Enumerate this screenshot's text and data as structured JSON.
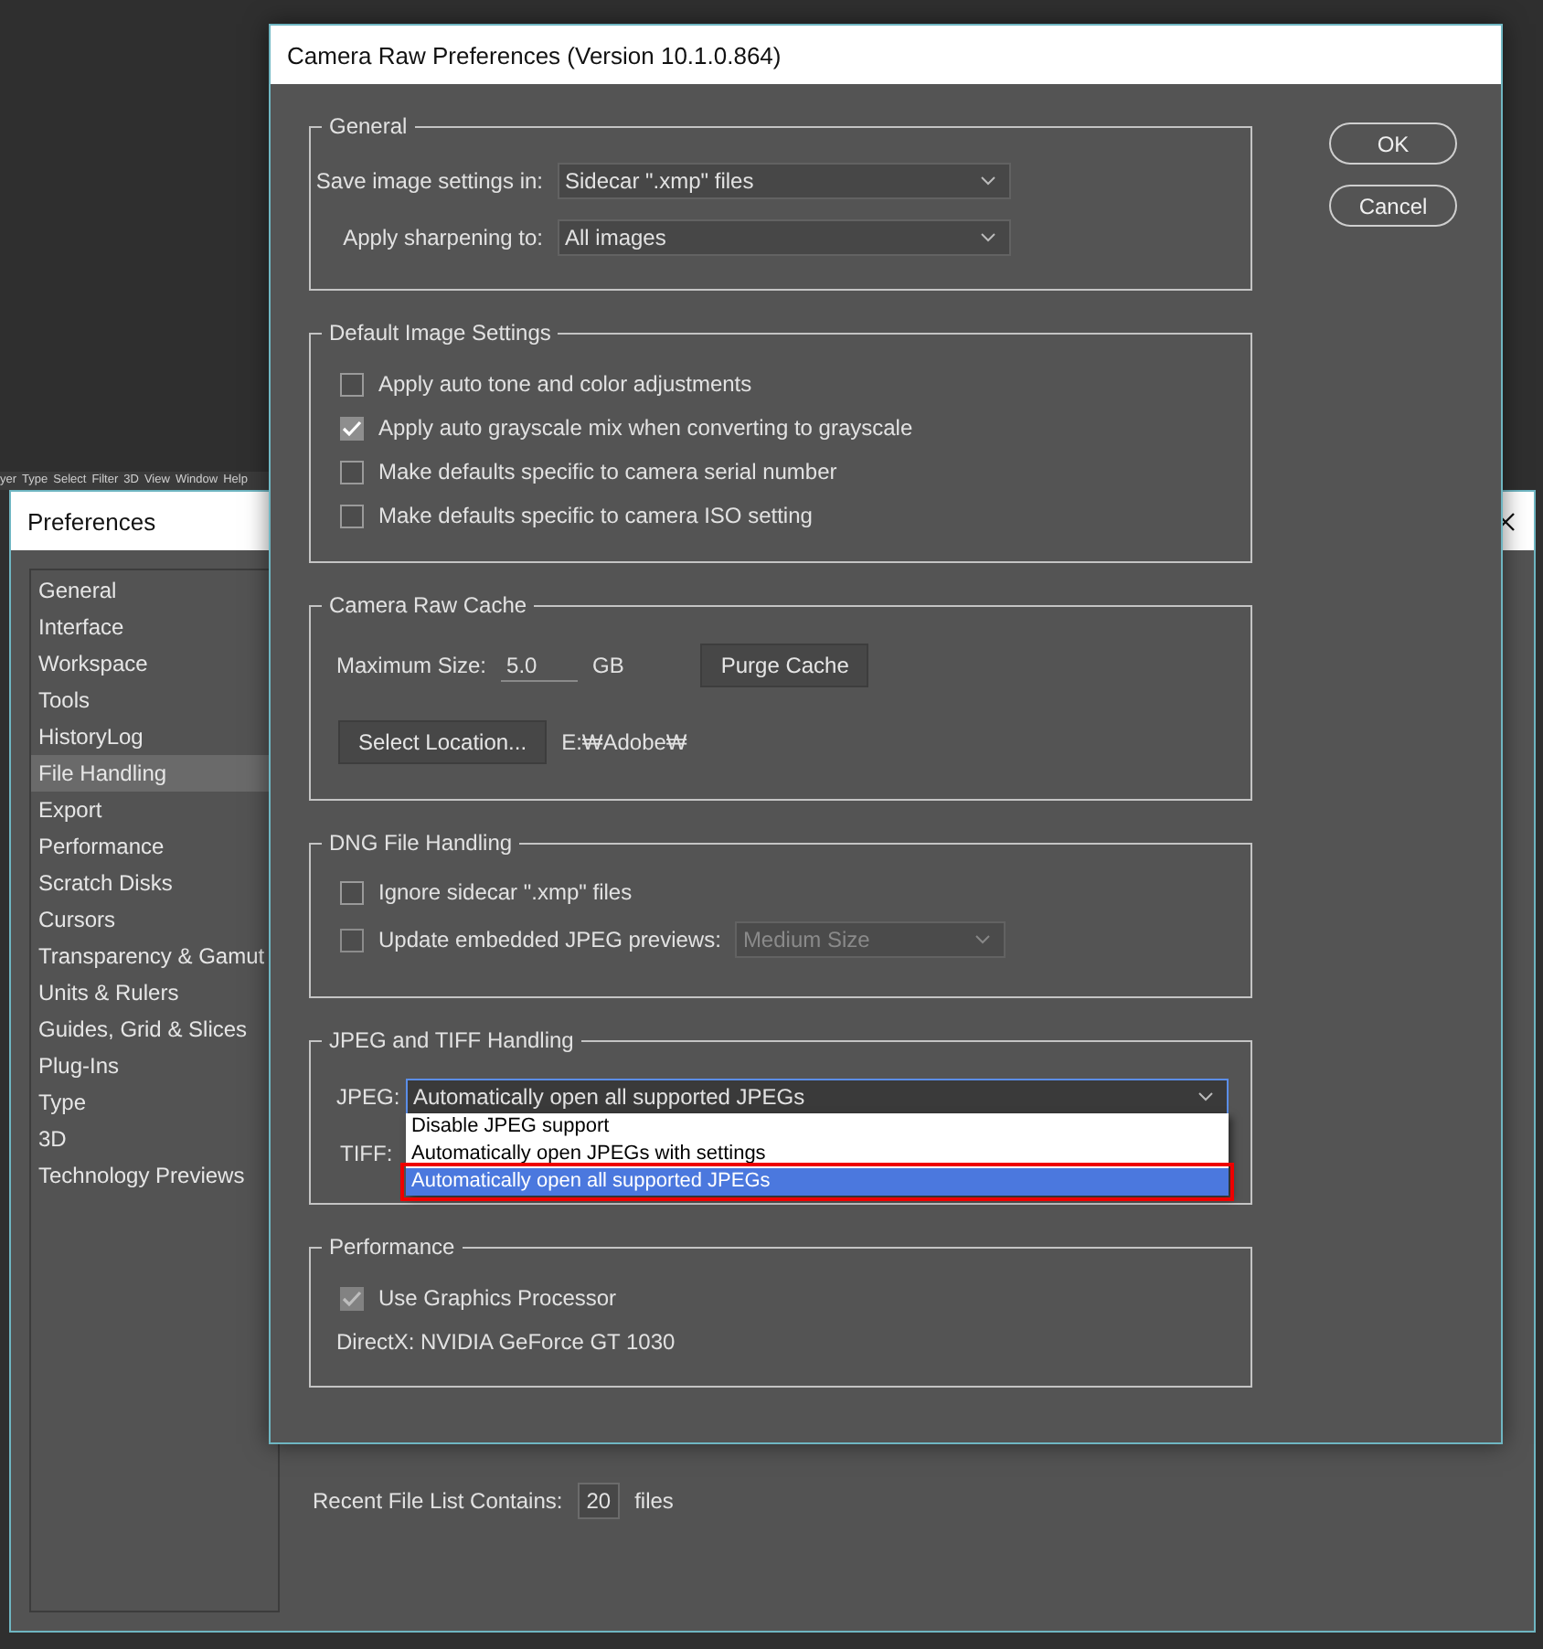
{
  "app_menu": [
    "yer",
    "Type",
    "Select",
    "Filter",
    "3D",
    "View",
    "Window",
    "Help"
  ],
  "preferences": {
    "title": "Preferences",
    "sidebar": [
      {
        "label": "General",
        "selected": false
      },
      {
        "label": "Interface",
        "selected": false
      },
      {
        "label": "Workspace",
        "selected": false
      },
      {
        "label": "Tools",
        "selected": false
      },
      {
        "label": "HistoryLog",
        "selected": false
      },
      {
        "label": "File Handling",
        "selected": true
      },
      {
        "label": "Export",
        "selected": false
      },
      {
        "label": "Performance",
        "selected": false
      },
      {
        "label": "Scratch Disks",
        "selected": false
      },
      {
        "label": "Cursors",
        "selected": false
      },
      {
        "label": "Transparency & Gamut",
        "selected": false
      },
      {
        "label": "Units & Rulers",
        "selected": false
      },
      {
        "label": "Guides, Grid & Slices",
        "selected": false
      },
      {
        "label": "Plug-Ins",
        "selected": false
      },
      {
        "label": "Type",
        "selected": false
      },
      {
        "label": "3D",
        "selected": false
      },
      {
        "label": "Technology Previews",
        "selected": false
      }
    ],
    "recent_files": {
      "label": "Recent File List Contains:",
      "value": "20",
      "unit": "files"
    }
  },
  "camera_raw": {
    "title": "Camera Raw Preferences  (Version 10.1.0.864)",
    "buttons": [
      "OK",
      "Cancel"
    ],
    "sections": [
      {
        "title": "General",
        "rows": [
          {
            "kind": "select",
            "label": "Save image settings in:",
            "value": "Sidecar \".xmp\" files"
          },
          {
            "kind": "select",
            "label": "Apply sharpening to:",
            "value": "All images"
          }
        ]
      },
      {
        "title": "Default Image Settings",
        "rows": [
          {
            "kind": "checkbox",
            "label": "Apply auto tone and color adjustments",
            "checked": false
          },
          {
            "kind": "checkbox",
            "label": "Apply auto grayscale mix when converting to grayscale",
            "checked": true
          },
          {
            "kind": "checkbox",
            "label": "Make defaults specific to camera serial number",
            "checked": false
          },
          {
            "kind": "checkbox",
            "label": "Make defaults specific to camera ISO setting",
            "checked": false
          }
        ]
      },
      {
        "title": "Camera Raw Cache",
        "rows": [
          {
            "kind": "size",
            "label": "Maximum Size:",
            "value": "5.0",
            "unit": "GB",
            "button": "Purge Cache"
          },
          {
            "kind": "location",
            "button": "Select Location...",
            "path": "E:₩Adobe₩"
          }
        ]
      },
      {
        "title": "DNG File Handling",
        "rows": [
          {
            "kind": "checkbox",
            "label": "Ignore sidecar \".xmp\" files",
            "checked": false
          },
          {
            "kind": "checkbox_select",
            "label": "Update embedded JPEG previews:",
            "checked": false,
            "value": "Medium Size",
            "disabled": true
          }
        ]
      },
      {
        "title": "JPEG and TIFF Handling",
        "rows": [
          {
            "kind": "dropdown",
            "label": "JPEG:",
            "value": "Automatically open all supported JPEGs",
            "open": true,
            "options": [
              {
                "label": "Disable JPEG support",
                "selected": false,
                "marked": false
              },
              {
                "label": "Automatically open JPEGs with settings",
                "selected": false,
                "marked": false
              },
              {
                "label": "Automatically open all supported JPEGs",
                "selected": true,
                "marked": true
              }
            ]
          },
          {
            "kind": "label",
            "label": "TIFF:"
          }
        ]
      },
      {
        "title": "Performance",
        "rows": [
          {
            "kind": "checkbox",
            "label": "Use Graphics Processor",
            "checked": true,
            "disabled": true
          },
          {
            "kind": "info",
            "text": "DirectX: NVIDIA GeForce GT 1030"
          }
        ]
      }
    ]
  }
}
